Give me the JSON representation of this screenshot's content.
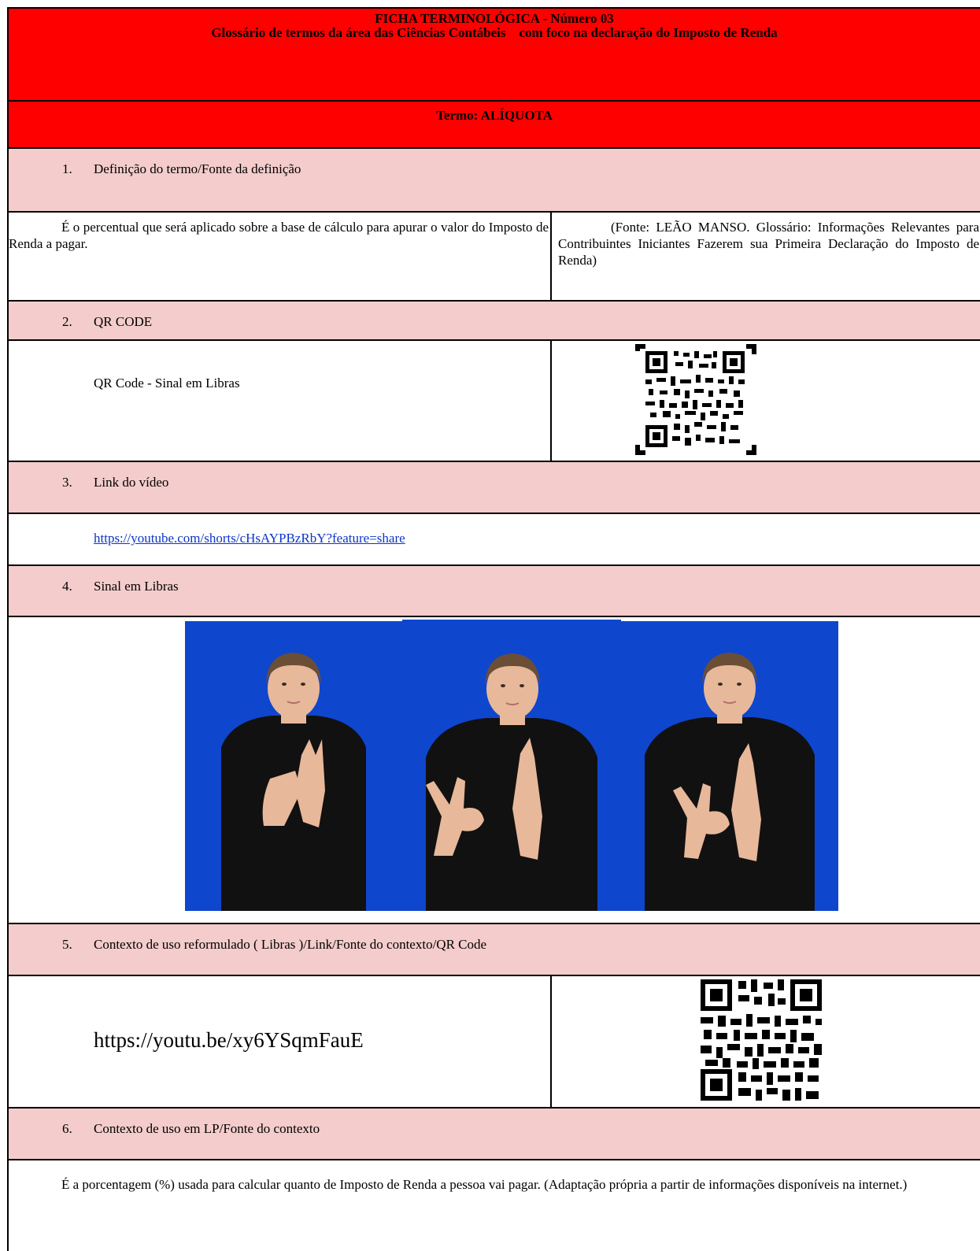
{
  "header": {
    "title_line1": "FICHA TERMINOLÓGICA - Número 03",
    "title_line2": "Glossário de termos da área das Ciências Contábeis    com foco na declaração do Imposto de Renda",
    "term": "Termo:  ALÍQUOTA"
  },
  "sections": [
    {
      "number": "1.",
      "title": "Definição do termo/Fonte da definição"
    },
    {
      "number": "2.",
      "title": "QR CODE"
    },
    {
      "number": "3.",
      "title": "Link do vídeo"
    },
    {
      "number": "4.",
      "title": "Sinal em  Libras"
    },
    {
      "number": "5.",
      "title": "Contexto de uso reformulado ( Libras )/Link/Fonte do contexto/QR Code"
    },
    {
      "number": "6.",
      "title": "Contexto de uso em LP/Fonte do contexto"
    }
  ],
  "definition": {
    "text": "É o percentual que será aplicado sobre a base de cálculo para apurar o valor do Imposto de Renda a pagar.",
    "source": "(Fonte: LEÃO MANSO. Glossário: Informações Relevantes para Contribuintes Iniciantes Fazerem sua Primeira Declaração do Imposto de Renda)"
  },
  "qr_section": {
    "label": "QR Code - Sinal em  Libras",
    "icon": "qr-code-icon"
  },
  "video_link": "https://youtube.com/shorts/cHsAYPBzRbY?feature=share",
  "sign_photos": {
    "count": 3,
    "background_color": "#0f46ce",
    "shirt_color": "#111111",
    "skin_color": "#e8b89a"
  },
  "context_libras": {
    "link": "https://youtu.be/xy6YSqmFauE",
    "icon": "qr-code-icon"
  },
  "context_lp": {
    "text": "É a porcentagem (%) usada para calcular quanto de Imposto de Renda a pessoa vai pagar. (Adaptação própria a partir de informações disponíveis na internet.)"
  },
  "colors": {
    "header_red": "#ff0000",
    "section_pink": "#f3cccb",
    "link_blue": "#0b35c9"
  }
}
